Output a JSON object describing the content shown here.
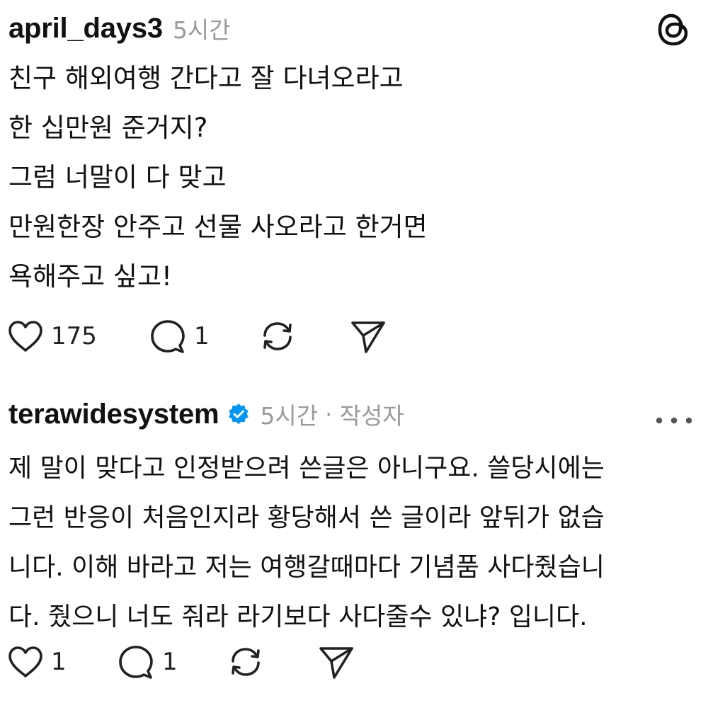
{
  "posts": [
    {
      "username": "april_days3",
      "time": "5시간",
      "lines": [
        "친구 해외여행 간다고 잘 다녀오라고",
        "한 십만원 준거지?",
        "그럼 너말이 다 맞고",
        "만원한장 안주고 선물 사오라고 한거면",
        "욕해주고 싶고!"
      ],
      "likes": "175",
      "replies": "1"
    },
    {
      "username": "terawidesystem",
      "verified": true,
      "time": "5시간",
      "separator": "·",
      "author_tag": "작성자",
      "lines": [
        "제 말이 맞다고 인정받으려 쓴글은 아니구요. 쓸당시에는",
        "그런 반응이 처음인지라 황당해서 쓴 글이라 앞뒤가 없습",
        "니다. 이해 바라고 저는 여행갈때마다 기념품 사다줬습니",
        "다. 줬으니 너도 줘라 라기보다 사다줄수 있냐? 입니다."
      ],
      "likes": "1",
      "replies": "1"
    }
  ],
  "icons": {
    "threads_logo": "threads-logo-icon",
    "verified": "verified-badge-icon",
    "more": "more-options-icon",
    "like": "heart-icon",
    "reply": "comment-icon",
    "repost": "repost-icon",
    "share": "send-icon"
  },
  "colors": {
    "text": "#111111",
    "muted": "#9a9a9a",
    "verified_blue": "#0095f6"
  }
}
